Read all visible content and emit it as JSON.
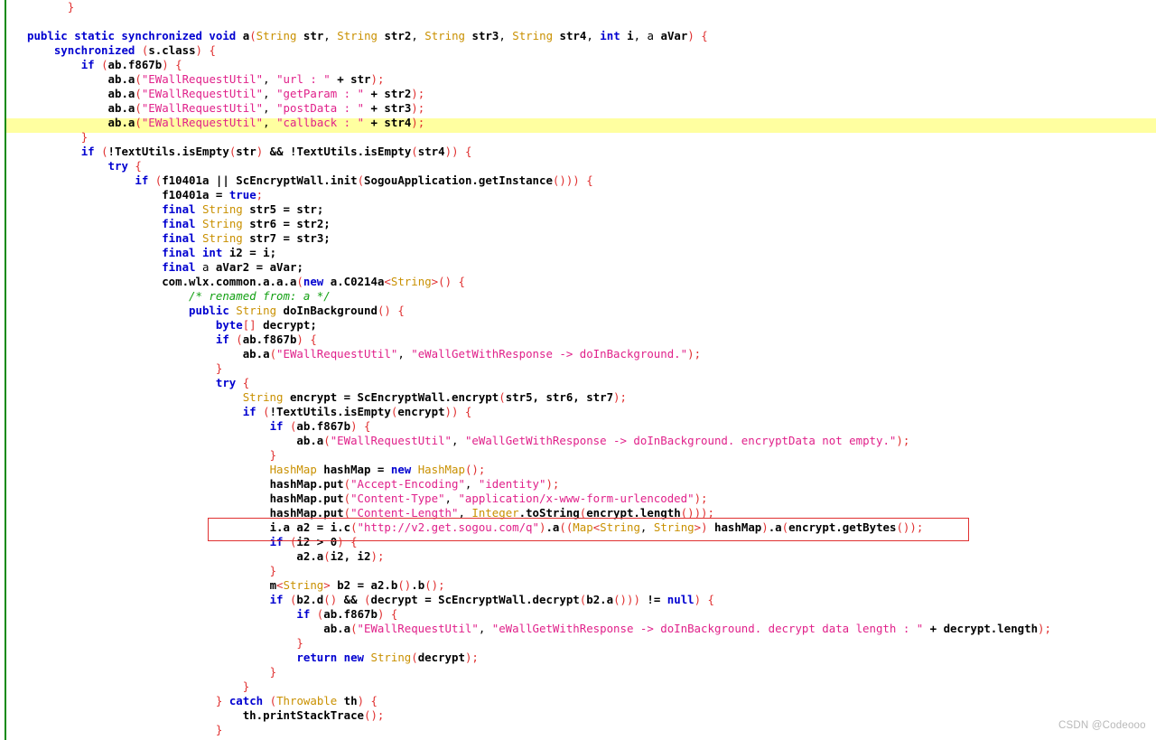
{
  "viewer": {
    "kind": "decompiled-java-source",
    "background": "#ffffff",
    "gutter_marker_color": "#0b8a0b",
    "highlight_color": "#ffffa0",
    "annotation_color": "#e03030"
  },
  "watermark": {
    "text": "CSDN @Codeooo"
  },
  "palette": {
    "keyword": "#0000d0",
    "type": "#c99000",
    "string": "#e0218a",
    "comment": "#12a012",
    "punctuation": "#e03030",
    "plain": "#000000",
    "highlight": "#ffffa0",
    "annotation": "#e03030",
    "marker": "#0b8a0b",
    "watermark": "#b8b8b8"
  },
  "code": {
    "language": "java",
    "highlighted_line_number": 9,
    "annotated_line_number": 37,
    "lines": [
      {
        "n": 1,
        "indent": 0,
        "text": "}"
      },
      {
        "n": 2,
        "indent": 0,
        "text": ""
      },
      {
        "n": 3,
        "indent": 0,
        "text": "public static synchronized void a(String str, String str2, String str3, String str4, int i, a aVar) {"
      },
      {
        "n": 4,
        "indent": 1,
        "text": "synchronized (s.class) {"
      },
      {
        "n": 5,
        "indent": 2,
        "text": "if (ab.f867b) {"
      },
      {
        "n": 6,
        "indent": 3,
        "text": "ab.a(\"EWallRequestUtil\", \"url : \" + str);"
      },
      {
        "n": 7,
        "indent": 3,
        "text": "ab.a(\"EWallRequestUtil\", \"getParam : \" + str2);"
      },
      {
        "n": 8,
        "indent": 3,
        "text": "ab.a(\"EWallRequestUtil\", \"postData : \" + str3);"
      },
      {
        "n": 9,
        "indent": 3,
        "text": "ab.a(\"EWallRequestUtil\", \"callback : \" + str4);"
      },
      {
        "n": 10,
        "indent": 2,
        "text": "}"
      },
      {
        "n": 11,
        "indent": 2,
        "text": "if (!TextUtils.isEmpty(str) && !TextUtils.isEmpty(str4)) {"
      },
      {
        "n": 12,
        "indent": 3,
        "text": "try {"
      },
      {
        "n": 13,
        "indent": 4,
        "text": "if (f10401a || ScEncryptWall.init(SogouApplication.getInstance())) {"
      },
      {
        "n": 14,
        "indent": 5,
        "text": "f10401a = true;"
      },
      {
        "n": 15,
        "indent": 5,
        "text": "final String str5 = str;"
      },
      {
        "n": 16,
        "indent": 5,
        "text": "final String str6 = str2;"
      },
      {
        "n": 17,
        "indent": 5,
        "text": "final String str7 = str3;"
      },
      {
        "n": 18,
        "indent": 5,
        "text": "final int i2 = i;"
      },
      {
        "n": 19,
        "indent": 5,
        "text": "final a aVar2 = aVar;"
      },
      {
        "n": 20,
        "indent": 5,
        "text": "com.wlx.common.a.a.a(new a.C0214a<String>() {"
      },
      {
        "n": 21,
        "indent": 6,
        "text": "/* renamed from: a */"
      },
      {
        "n": 22,
        "indent": 6,
        "text": "public String doInBackground() {"
      },
      {
        "n": 23,
        "indent": 7,
        "text": "byte[] decrypt;"
      },
      {
        "n": 24,
        "indent": 7,
        "text": "if (ab.f867b) {"
      },
      {
        "n": 25,
        "indent": 8,
        "text": "ab.a(\"EWallRequestUtil\", \"eWallGetWithResponse -> doInBackground.\");"
      },
      {
        "n": 26,
        "indent": 7,
        "text": "}"
      },
      {
        "n": 27,
        "indent": 7,
        "text": "try {"
      },
      {
        "n": 28,
        "indent": 8,
        "text": "String encrypt = ScEncryptWall.encrypt(str5, str6, str7);"
      },
      {
        "n": 29,
        "indent": 8,
        "text": "if (!TextUtils.isEmpty(encrypt)) {"
      },
      {
        "n": 30,
        "indent": 9,
        "text": "if (ab.f867b) {"
      },
      {
        "n": 31,
        "indent": 10,
        "text": "ab.a(\"EWallRequestUtil\", \"eWallGetWithResponse -> doInBackground. encryptData not empty.\");"
      },
      {
        "n": 32,
        "indent": 9,
        "text": "}"
      },
      {
        "n": 33,
        "indent": 9,
        "text": "HashMap hashMap = new HashMap();"
      },
      {
        "n": 34,
        "indent": 9,
        "text": "hashMap.put(\"Accept-Encoding\", \"identity\");"
      },
      {
        "n": 35,
        "indent": 9,
        "text": "hashMap.put(\"Content-Type\", \"application/x-www-form-urlencoded\");"
      },
      {
        "n": 36,
        "indent": 9,
        "text": "hashMap.put(\"Content-Length\", Integer.toString(encrypt.length()));"
      },
      {
        "n": 37,
        "indent": 9,
        "text": "i.a a2 = i.c(\"http://v2.get.sogou.com/q\").a((Map<String, String>) hashMap).a(encrypt.getBytes());"
      },
      {
        "n": 38,
        "indent": 9,
        "text": "if (i2 > 0) {"
      },
      {
        "n": 39,
        "indent": 10,
        "text": "a2.a(i2, i2);"
      },
      {
        "n": 40,
        "indent": 9,
        "text": "}"
      },
      {
        "n": 41,
        "indent": 9,
        "text": "m<String> b2 = a2.b().b();"
      },
      {
        "n": 42,
        "indent": 9,
        "text": "if (b2.d() && (decrypt = ScEncryptWall.decrypt(b2.a())) != null) {"
      },
      {
        "n": 43,
        "indent": 10,
        "text": "if (ab.f867b) {"
      },
      {
        "n": 44,
        "indent": 11,
        "text": "ab.a(\"EWallRequestUtil\", \"eWallGetWithResponse -> doInBackground. decrypt data length : \" + decrypt.length);"
      },
      {
        "n": 45,
        "indent": 10,
        "text": "}"
      },
      {
        "n": 46,
        "indent": 10,
        "text": "return new String(decrypt);"
      },
      {
        "n": 47,
        "indent": 9,
        "text": "}"
      },
      {
        "n": 48,
        "indent": 8,
        "text": "}"
      },
      {
        "n": 49,
        "indent": 7,
        "text": "} catch (Throwable th) {"
      },
      {
        "n": 50,
        "indent": 8,
        "text": "th.printStackTrace();"
      },
      {
        "n": 51,
        "indent": 7,
        "text": "}"
      }
    ]
  }
}
